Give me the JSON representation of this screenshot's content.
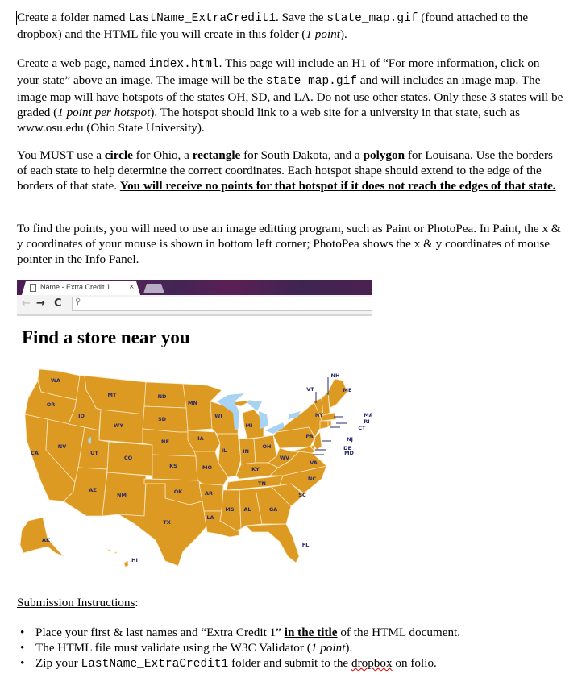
{
  "document": {
    "para1": {
      "t1": "Create a folder named ",
      "code1": "LastName_ExtraCredit1",
      "t2": ". Save the ",
      "code2": "state_map.gif",
      "t3": " (found attached to the dropbox) and the HTML file you will create in this folder (",
      "em": "1 point",
      "t4": ")."
    },
    "para2": {
      "t1": "Create a web page, named ",
      "code1": "index.html",
      "t2": ". This page will include an H1 of “For more information, click on your state” above an image. The image will be the ",
      "code2": "state_map.gif",
      "t3": " and will includes an image map. The image map will have hotspots of the states OH, SD, and LA. Do not use other states. Only these 3 states will be graded (",
      "em": "1 point per hotspot",
      "t4": "). The hotspot should link to a web site for a university in that state, such as www.osu.edu (Ohio State University)."
    },
    "para3": {
      "t1": "You MUST use a ",
      "b1": "circle",
      "t2": " for Ohio, a ",
      "b2": "rectangle",
      "t3": " for South Dakota, and a ",
      "b3": "polygon",
      "t4": " for Louisana. Use the borders of each state to help determine the correct coordinates. Each hotspot shape should extend to the edge of the borders of that state. ",
      "warning": "You will receive no points for that hotspot if it does not reach the edges of that state."
    },
    "para4": {
      "text": "To find the points, you will need to use an image editting program, such as Paint or PhotoPea. In Paint, the x & y coordinates of your mouse is shown in bottom left corner; PhotoPea shows the x & y coordinates of mouse pointer in the Info Panel."
    },
    "submission_heading": "Submission Instructions",
    "submission_colon": ":",
    "submission_items": [
      {
        "t1": "Place your first & last names and “Extra Credit 1” ",
        "bu": "in the title",
        "t2": " of the HTML document."
      },
      {
        "t1": "The HTML file must validate using the W3C Validator (",
        "em": "1 point",
        "t2": ")."
      },
      {
        "t1": "Zip your ",
        "code": "LastName_ExtraCredit1",
        "t2": " folder and submit to the ",
        "squiggle": "dropbox",
        "t3": " on folio."
      }
    ],
    "bullet_glyph": "•"
  },
  "browser_screenshot": {
    "tab_title": "Name - Extra Credit 1",
    "tab_close": "×",
    "back_icon": "←",
    "forward_icon": "→",
    "reload_icon": "C",
    "search_icon": "⚲",
    "page_heading": "Find a store near you",
    "colors": {
      "state_fill": "#dc9a22",
      "state_border": "#fbe8c4",
      "label": "#2a2a6e",
      "water": "#a9d3f2",
      "tab_strip": "#4b2152"
    },
    "state_labels": [
      "WA",
      "OR",
      "CA",
      "ID",
      "NV",
      "MT",
      "WY",
      "UT",
      "AZ",
      "CO",
      "NM",
      "ND",
      "SD",
      "NE",
      "KS",
      "OK",
      "TX",
      "MN",
      "IA",
      "MO",
      "AR",
      "LA",
      "WI",
      "IL",
      "MS",
      "MI",
      "IN",
      "KY",
      "TN",
      "AL",
      "OH",
      "WV",
      "GA",
      "SC",
      "FL",
      "NC",
      "VA",
      "PA",
      "NY",
      "VT",
      "NH",
      "ME",
      "MA",
      "RI",
      "CT",
      "NJ",
      "DE",
      "MD",
      "AK",
      "HI"
    ]
  }
}
